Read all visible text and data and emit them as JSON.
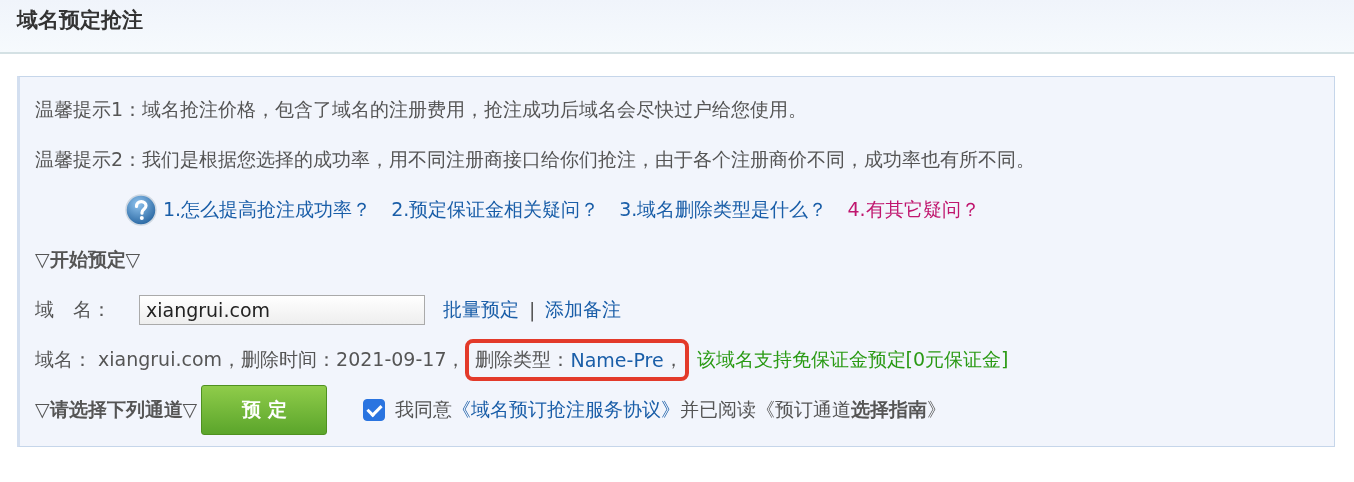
{
  "page_title": "域名预定抢注",
  "tips": [
    "温馨提示1：域名抢注价格，包含了域名的注册费用，抢注成功后域名会尽快过户给您使用。",
    "温馨提示2：我们是根据您选择的成功率，用不同注册商接口给你们抢注，由于各个注册商价不同，成功率也有所不同。"
  ],
  "help_links": [
    {
      "label": "1.怎么提高抢注成功率？",
      "color": "#1a5ea8"
    },
    {
      "label": "2.预定保证金相关疑问？",
      "color": "#1a5ea8"
    },
    {
      "label": "3.域名删除类型是什么？",
      "color": "#1a5ea8"
    },
    {
      "label": "4.有其它疑问？",
      "color": "#c0166e"
    }
  ],
  "section_heading": "▽开始预定▽",
  "domain_field": {
    "label": "域　名：",
    "value": "xiangrui.com"
  },
  "field_links": [
    "批量预定",
    "添加备注"
  ],
  "field_links_separator": "|",
  "domain_info": {
    "text": "域名： xiangrui.com，删除时间：2021-09-17，",
    "delete_type_label": "删除类型：",
    "delete_type": "Name-Pre",
    "delete_type_suffix": "，",
    "highlighted": true,
    "notice": "该域名支持免保证金预定[0元保证金]"
  },
  "channel_heading": "▽请选择下列通道▽",
  "reserve_button": "预 定",
  "agreement": {
    "checked": true,
    "prefix": "我同意",
    "link": "《域名预订抢注服务协议》",
    "suffix": "并已阅读《预订通道**选择指南**》"
  }
}
